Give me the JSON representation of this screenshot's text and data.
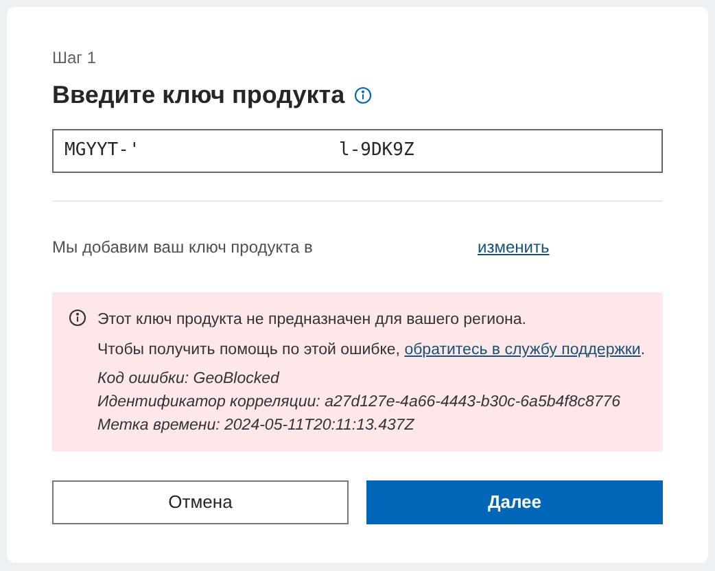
{
  "step": "Шаг 1",
  "title": "Введите ключ продукта",
  "key_field": {
    "value_start": "MGYYT-'",
    "value_end": "l-9DK9Z"
  },
  "account_note": {
    "text": "Мы добавим ваш ключ продукта в",
    "link": "изменить"
  },
  "error": {
    "message": "Этот ключ продукта не предназначен для вашего региона.",
    "help_text": "Чтобы получить помощь по этой ошибке,",
    "help_link": "обратитесь в службу поддержки",
    "help_end": ".",
    "details": [
      "Код ошибки: GeoBlocked",
      "Идентификатор корреляции: a27d127e-4a66-4443-b30c-6a5b4f8c8776",
      "Метка времени: 2024-05-11T20:11:13.437Z"
    ]
  },
  "buttons": [
    {
      "label": "Отмена",
      "kind": "secondary"
    },
    {
      "label": "Далее",
      "kind": "primary"
    }
  ]
}
